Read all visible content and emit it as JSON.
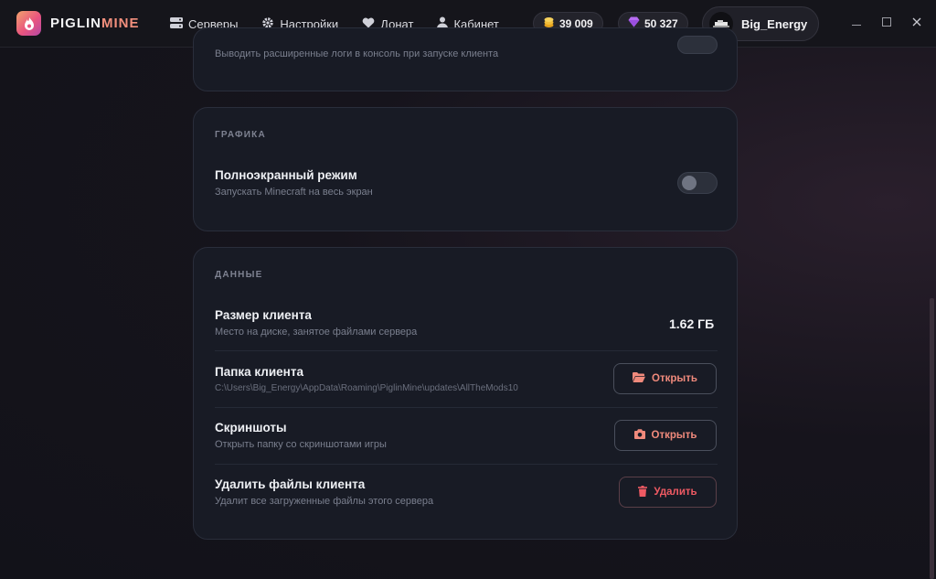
{
  "app": {
    "name_part1": "PIGLIN",
    "name_part2": "MINE"
  },
  "nav": [
    {
      "label": "Серверы",
      "icon": "servers-icon"
    },
    {
      "label": "Настройки",
      "icon": "gear-icon"
    },
    {
      "label": "Донат",
      "icon": "heart-icon"
    },
    {
      "label": "Кабинет",
      "icon": "user-icon"
    }
  ],
  "balances": {
    "coins": "39 009",
    "gems": "50 327"
  },
  "user": {
    "name": "Big_Energy"
  },
  "debug": {
    "desc": "Выводить расширенные логи в консоль при запуске клиента"
  },
  "graphics": {
    "title": "ГРАФИКА",
    "fullscreen_title": "Полноэкранный режим",
    "fullscreen_desc": "Запускать Minecraft на весь экран",
    "fullscreen_enabled": false
  },
  "data": {
    "title": "ДАННЫЕ",
    "size_title": "Размер клиента",
    "size_desc": "Место на диске, занятое файлами сервера",
    "size_value": "1.62 ГБ",
    "folder_title": "Папка клиента",
    "folder_path": "C:\\Users\\Big_Energy\\AppData\\Roaming\\PiglinMine\\updates\\AllTheMods10",
    "folder_button": "Открыть",
    "screens_title": "Скриншоты",
    "screens_desc": "Открыть папку со скриншотами игры",
    "screens_button": "Открыть",
    "delete_title": "Удалить файлы клиента",
    "delete_desc": "Удалит все загруженные файлы этого сервера",
    "delete_button": "Удалить"
  },
  "colors": {
    "accent": "#f08a7c",
    "danger": "#ef5a63",
    "card": "#181b25"
  }
}
